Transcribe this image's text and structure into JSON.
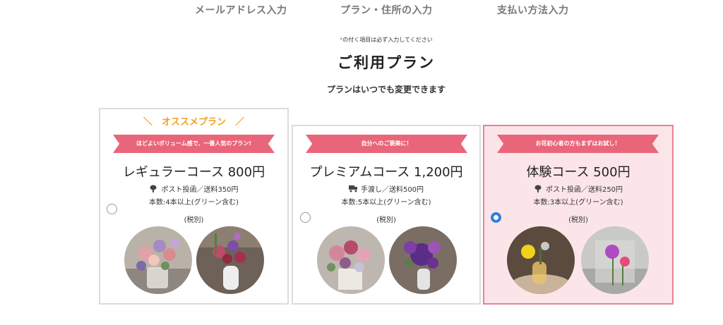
{
  "steps": [
    "メールアドレス入力",
    "プラン・住所の入力",
    "支払い方法入力"
  ],
  "required_note": {
    "mark": "*",
    "text": "の付く項目は必ず入力してください"
  },
  "page_title": "ご利用プラン",
  "subtitle": "プランはいつでも変更できます",
  "plans": [
    {
      "recommend_label": "＼　オススメプラン　／",
      "ribbon": "ほどよいボリューム感で、一番人気のプラン!",
      "name": "レギュラーコース 800円",
      "shipping_icon": "post-icon",
      "shipping": "ポスト投函／送料350円",
      "stems": "本数:4本以上(グリーン含む)",
      "tax": "(税別)",
      "selected": false
    },
    {
      "ribbon": "自分へのご褒美に！",
      "name": "プレミアムコース 1,200円",
      "shipping_icon": "truck-icon",
      "shipping": "手渡し／送料500円",
      "stems": "本数:5本以上(グリーン含む)",
      "tax": "(税別)",
      "selected": false
    },
    {
      "ribbon": "お花初心者の方もまずはお試し！",
      "name": "体験コース 500円",
      "shipping_icon": "post-icon",
      "shipping": "ポスト投函／送料250円",
      "stems": "本数:3本以上(グリーン含む)",
      "tax": "(税別)",
      "selected": true
    }
  ],
  "colors": {
    "accent_pink": "#e9667a",
    "recommend_orange": "#f0a020",
    "selected_bg": "#fbe5e9",
    "radio_blue": "#2f7de1"
  }
}
